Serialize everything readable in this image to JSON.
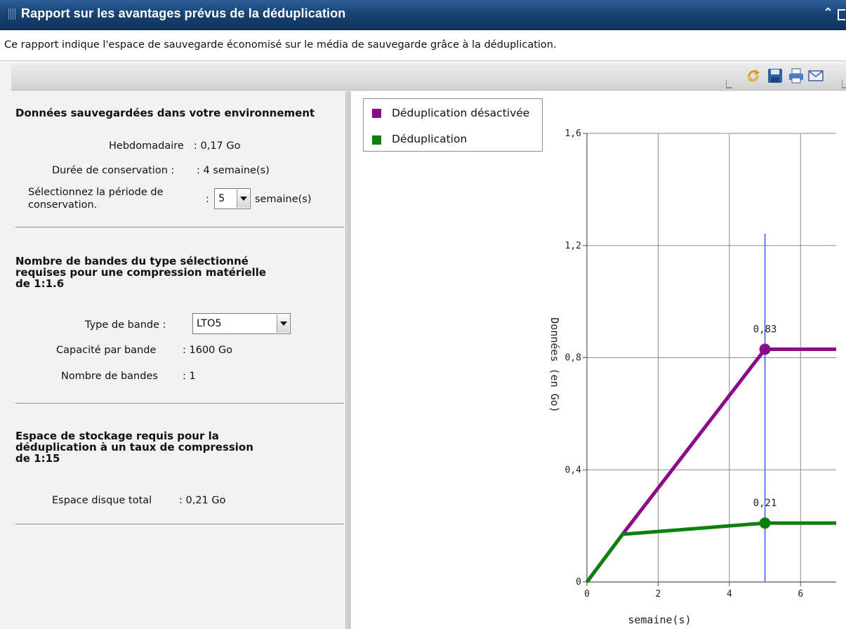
{
  "window": {
    "title": "Rapport sur les avantages prévus de la déduplication",
    "description": "Ce rapport indique l'espace de sauvegarde économisé sur le média de sauvegarde grâce à la déduplication."
  },
  "toolbar": {
    "icons": [
      "refresh-icon",
      "save-icon",
      "print-icon",
      "email-icon"
    ]
  },
  "section_data": {
    "title": "Données sauvegardées dans votre environnement",
    "weekly_label": "Hebdomadaire",
    "weekly_value": ": 0,17  Go",
    "retention_label": "Durée de conservation :",
    "retention_value": ":  4  semaine(s)",
    "select_period_label_line1": "Sélectionnez la période de",
    "select_period_label_line2": "conservation.",
    "select_colon": ":",
    "period_selected": "5",
    "period_unit": "semaine(s)"
  },
  "section_tapes": {
    "title_line1": "Nombre de bandes du type sélectionné",
    "title_line2": "requises pour une compression matérielle",
    "title_line3": "de 1:1.6",
    "tape_type_label": "Type de bande  :",
    "tape_type_selected": "LTO5",
    "capacity_label": "Capacité par bande",
    "capacity_value": ":  1600  Go",
    "count_label": "Nombre de bandes",
    "count_value": ":  1"
  },
  "section_storage": {
    "title_line1": "Espace de stockage requis pour la",
    "title_line2": "déduplication à un taux de compression",
    "title_line3": "de 1:15",
    "disk_label": "Espace disque total",
    "disk_value": ":  0,21  Go"
  },
  "legend": {
    "items": [
      {
        "label": "Déduplication désactivée",
        "color": "#8a0a8a"
      },
      {
        "label": "Déduplication",
        "color": "#0b800b"
      }
    ]
  },
  "chart_data": {
    "type": "line",
    "xlabel": "semaine(s)",
    "ylabel": "Données (en Go)",
    "xlim": [
      0,
      7
    ],
    "ylim": [
      0,
      1.6
    ],
    "x_ticks": [
      "0",
      "2",
      "4",
      "6"
    ],
    "y_ticks": [
      "0",
      "0,4",
      "0,8",
      "1,2",
      "1,6"
    ],
    "grid": true,
    "marker_x": 5,
    "series": [
      {
        "name": "Déduplication désactivée",
        "color": "#8a0a8a",
        "points": [
          [
            0,
            0
          ],
          [
            1,
            0.17
          ],
          [
            5,
            0.83
          ],
          [
            7,
            0.83
          ]
        ],
        "highlight": {
          "x": 5,
          "y": 0.83,
          "label": "0,83"
        }
      },
      {
        "name": "Déduplication",
        "color": "#0b800b",
        "points": [
          [
            0,
            0
          ],
          [
            1,
            0.17
          ],
          [
            5,
            0.21
          ],
          [
            7,
            0.21
          ]
        ],
        "highlight": {
          "x": 5,
          "y": 0.21,
          "label": "0,21"
        }
      }
    ]
  }
}
